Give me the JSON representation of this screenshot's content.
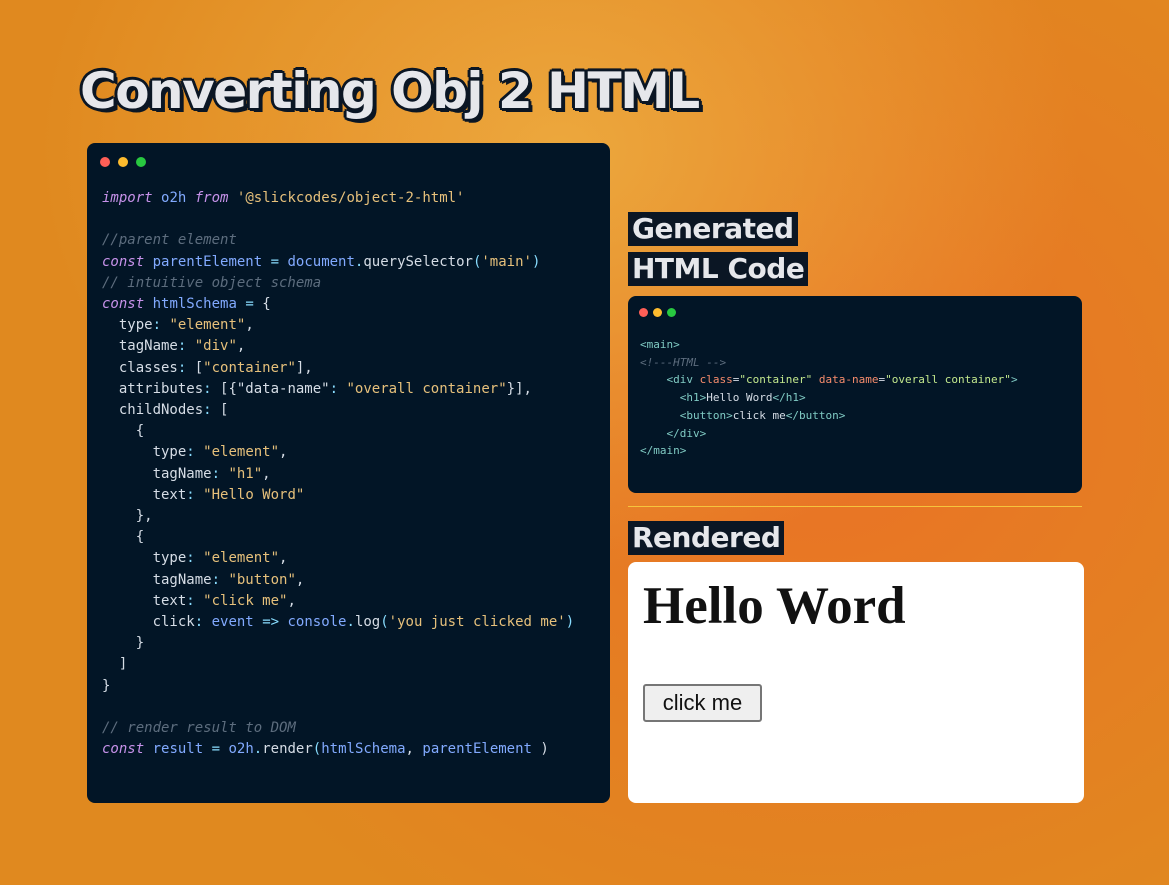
{
  "title": "Converting Obj 2 HTML",
  "window_dots": {
    "red": "#ff5f57",
    "yellow": "#febc2e",
    "green": "#28c840"
  },
  "code_panel": {
    "lines": [
      [
        [
          "kw",
          "import"
        ],
        [
          "fn",
          " "
        ],
        [
          "id",
          "o2h"
        ],
        [
          "fn",
          " "
        ],
        [
          "kw",
          "from"
        ],
        [
          "fn",
          " "
        ],
        [
          "st",
          "'@slickcodes/object-2-html'"
        ]
      ],
      [],
      [
        [
          "cm",
          "//parent element"
        ]
      ],
      [
        [
          "kw",
          "const"
        ],
        [
          "fn",
          " "
        ],
        [
          "id",
          "parentElement"
        ],
        [
          "fn",
          " "
        ],
        [
          "pn",
          "="
        ],
        [
          "fn",
          " "
        ],
        [
          "id",
          "document"
        ],
        [
          "pn",
          "."
        ],
        [
          "fn",
          "querySelector"
        ],
        [
          "pn",
          "("
        ],
        [
          "st",
          "'main'"
        ],
        [
          "pn",
          ")"
        ]
      ],
      [
        [
          "cm",
          "// intuitive object schema"
        ]
      ],
      [
        [
          "kw",
          "const"
        ],
        [
          "fn",
          " "
        ],
        [
          "id",
          "htmlSchema"
        ],
        [
          "fn",
          " "
        ],
        [
          "pn",
          "="
        ],
        [
          "fn",
          " {"
        ]
      ],
      [
        [
          "fn",
          "  type"
        ],
        [
          "pn",
          ":"
        ],
        [
          "fn",
          " "
        ],
        [
          "st",
          "\"element\""
        ],
        [
          "fn",
          ","
        ]
      ],
      [
        [
          "fn",
          "  tagName"
        ],
        [
          "pn",
          ":"
        ],
        [
          "fn",
          " "
        ],
        [
          "st",
          "\"div\""
        ],
        [
          "fn",
          ","
        ]
      ],
      [
        [
          "fn",
          "  classes"
        ],
        [
          "pn",
          ":"
        ],
        [
          "fn",
          " ["
        ],
        [
          "st",
          "\"container\""
        ],
        [
          "fn",
          "],"
        ]
      ],
      [
        [
          "fn",
          "  attributes"
        ],
        [
          "pn",
          ":"
        ],
        [
          "fn",
          " [{\"data-name\""
        ],
        [
          "pn",
          ":"
        ],
        [
          "fn",
          " "
        ],
        [
          "st",
          "\"overall container\""
        ],
        [
          "fn",
          "}],"
        ]
      ],
      [
        [
          "fn",
          "  childNodes"
        ],
        [
          "pn",
          ":"
        ],
        [
          "fn",
          " ["
        ]
      ],
      [
        [
          "fn",
          "    {"
        ]
      ],
      [
        [
          "fn",
          "      type"
        ],
        [
          "pn",
          ":"
        ],
        [
          "fn",
          " "
        ],
        [
          "st",
          "\"element\""
        ],
        [
          "fn",
          ","
        ]
      ],
      [
        [
          "fn",
          "      tagName"
        ],
        [
          "pn",
          ":"
        ],
        [
          "fn",
          " "
        ],
        [
          "st",
          "\"h1\""
        ],
        [
          "fn",
          ","
        ]
      ],
      [
        [
          "fn",
          "      text"
        ],
        [
          "pn",
          ":"
        ],
        [
          "fn",
          " "
        ],
        [
          "st",
          "\"Hello Word\""
        ]
      ],
      [
        [
          "fn",
          "    },"
        ]
      ],
      [
        [
          "fn",
          "    {"
        ]
      ],
      [
        [
          "fn",
          "      type"
        ],
        [
          "pn",
          ":"
        ],
        [
          "fn",
          " "
        ],
        [
          "st",
          "\"element\""
        ],
        [
          "fn",
          ","
        ]
      ],
      [
        [
          "fn",
          "      tagName"
        ],
        [
          "pn",
          ":"
        ],
        [
          "fn",
          " "
        ],
        [
          "st",
          "\"button\""
        ],
        [
          "fn",
          ","
        ]
      ],
      [
        [
          "fn",
          "      text"
        ],
        [
          "pn",
          ":"
        ],
        [
          "fn",
          " "
        ],
        [
          "st",
          "\"click me\""
        ],
        [
          "fn",
          ","
        ]
      ],
      [
        [
          "fn",
          "      click"
        ],
        [
          "pn",
          ":"
        ],
        [
          "fn",
          " "
        ],
        [
          "id",
          "event"
        ],
        [
          "fn",
          " "
        ],
        [
          "pn",
          "=>"
        ],
        [
          "fn",
          " "
        ],
        [
          "id",
          "console"
        ],
        [
          "pn",
          "."
        ],
        [
          "fn",
          "log"
        ],
        [
          "pn",
          "("
        ],
        [
          "st",
          "'you just clicked me'"
        ],
        [
          "pn",
          ")"
        ]
      ],
      [
        [
          "fn",
          "    }"
        ]
      ],
      [
        [
          "fn",
          "  ]"
        ]
      ],
      [
        [
          "fn",
          "}"
        ]
      ],
      [],
      [
        [
          "cm",
          "// render result to DOM"
        ]
      ],
      [
        [
          "kw",
          "const"
        ],
        [
          "fn",
          " "
        ],
        [
          "id",
          "result"
        ],
        [
          "fn",
          " "
        ],
        [
          "pn",
          "="
        ],
        [
          "fn",
          " "
        ],
        [
          "id",
          "o2h"
        ],
        [
          "pn",
          "."
        ],
        [
          "fn",
          "render"
        ],
        [
          "pn",
          "("
        ],
        [
          "id",
          "htmlSchema"
        ],
        [
          "fn",
          ", "
        ],
        [
          "id",
          "parentElement"
        ],
        [
          "fn",
          " )"
        ]
      ]
    ]
  },
  "generated_heading": {
    "line1": "Generated",
    "line2": "HTML Code"
  },
  "html_panel": {
    "lines": [
      [
        [
          "tg",
          "<main>"
        ]
      ],
      [
        [
          "cm",
          "<!---HTML -->"
        ]
      ],
      [
        [
          "fn",
          "    "
        ],
        [
          "tg",
          "<div "
        ],
        [
          "at",
          "class"
        ],
        [
          "fn",
          "="
        ],
        [
          "sv",
          "\"container\""
        ],
        [
          "fn",
          " "
        ],
        [
          "at",
          "data-name"
        ],
        [
          "fn",
          "="
        ],
        [
          "sv",
          "\"overall container\""
        ],
        [
          "tg",
          ">"
        ]
      ],
      [
        [
          "fn",
          "      "
        ],
        [
          "tg",
          "<h1>"
        ],
        [
          "fn",
          "Hello Word"
        ],
        [
          "tg",
          "</h1>"
        ]
      ],
      [
        [
          "fn",
          "      "
        ],
        [
          "tg",
          "<button>"
        ],
        [
          "fn",
          "click me"
        ],
        [
          "tg",
          "</button>"
        ]
      ],
      [
        [
          "fn",
          "    "
        ],
        [
          "tg",
          "</div>"
        ]
      ],
      [
        [
          "tg",
          "</main>"
        ]
      ]
    ]
  },
  "rendered_heading": "Rendered",
  "rendered": {
    "heading": "Hello Word",
    "button": "click me"
  }
}
